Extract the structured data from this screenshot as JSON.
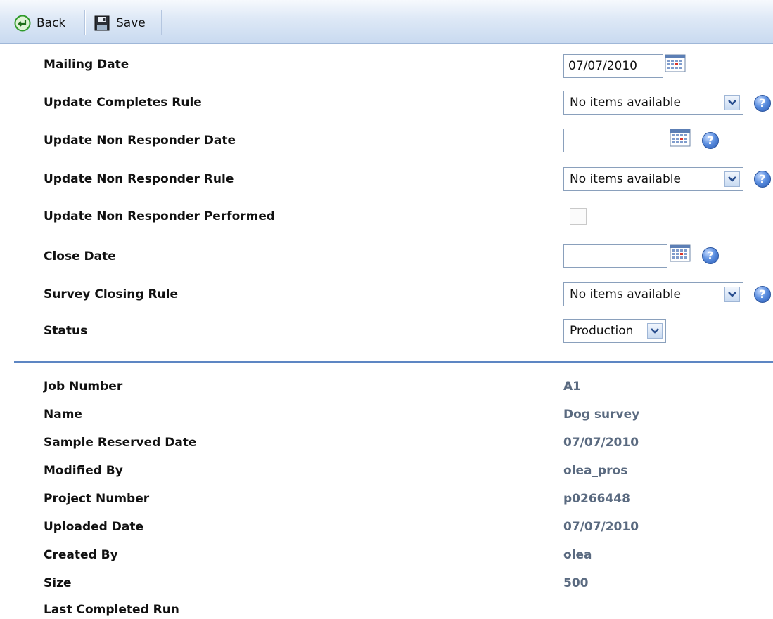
{
  "toolbar": {
    "back_label": "Back",
    "save_label": "Save"
  },
  "form": {
    "mailing_date": {
      "label": "Mailing Date",
      "value": "07/07/2010"
    },
    "update_completes_rule": {
      "label": "Update Completes Rule",
      "selected": "No items available"
    },
    "update_non_responder_date": {
      "label": "Update Non Responder Date",
      "value": ""
    },
    "update_non_responder_rule": {
      "label": "Update Non Responder Rule",
      "selected": "No items available"
    },
    "update_non_responder_performed": {
      "label": "Update Non Responder Performed",
      "checked": false
    },
    "close_date": {
      "label": "Close Date",
      "value": ""
    },
    "survey_closing_rule": {
      "label": "Survey Closing Rule",
      "selected": "No items available"
    },
    "status": {
      "label": "Status",
      "selected": "Production"
    }
  },
  "details": [
    {
      "label": "Job Number",
      "value": "A1"
    },
    {
      "label": "Name",
      "value": "Dog survey"
    },
    {
      "label": "Sample Reserved Date",
      "value": "07/07/2010"
    },
    {
      "label": "Modified By",
      "value": "olea_pros"
    },
    {
      "label": "Project Number",
      "value": "p0266448"
    },
    {
      "label": "Uploaded Date",
      "value": "07/07/2010"
    },
    {
      "label": "Created By",
      "value": "olea"
    },
    {
      "label": "Size",
      "value": "500"
    },
    {
      "label": "Last Completed Run",
      "value": ""
    }
  ],
  "icons": {
    "back": "back-arrow-icon",
    "save": "floppy-disk-icon",
    "calendar": "calendar-icon",
    "help": "help-icon",
    "dropdown": "chevron-down-icon"
  },
  "help_glyph": "?",
  "colors": {
    "toolbar_gradient_top": "#f6f9fd",
    "toolbar_gradient_bottom": "#c9daf0",
    "divider": "#5d86c3",
    "detail_value": "#5a6a80",
    "help_blue": "#2a5bb5",
    "back_green": "#2f9a2a"
  }
}
